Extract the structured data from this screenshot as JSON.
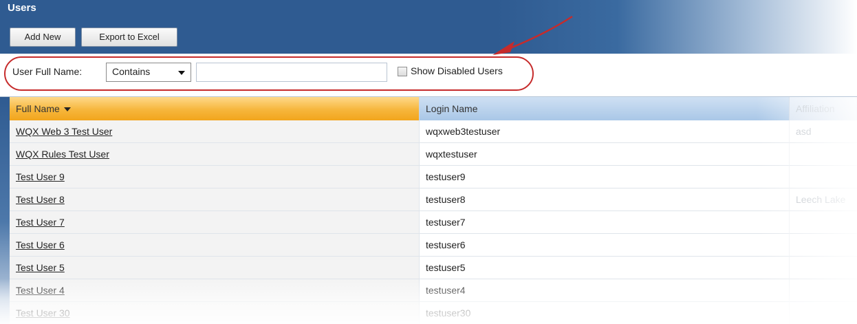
{
  "header": {
    "title": "Users",
    "add_new_label": "Add New",
    "export_label": "Export to Excel"
  },
  "filter": {
    "label": "User Full Name:",
    "operator_selected": "Contains",
    "value": "",
    "show_disabled_label": "Show Disabled Users",
    "show_disabled_checked": false
  },
  "grid": {
    "columns": [
      "Full Name",
      "Login Name",
      "Affiliation"
    ],
    "sort_column": "Full Name",
    "sort_direction": "descending",
    "rows": [
      {
        "full_name": "WQX Web 3 Test User",
        "login": "wqxweb3testuser",
        "affiliation": "asd"
      },
      {
        "full_name": "WQX Rules Test User",
        "login": "wqxtestuser",
        "affiliation": ""
      },
      {
        "full_name": "Test User 9",
        "login": "testuser9",
        "affiliation": ""
      },
      {
        "full_name": "Test User 8",
        "login": "testuser8",
        "affiliation": "Leech Lake"
      },
      {
        "full_name": "Test User 7",
        "login": "testuser7",
        "affiliation": ""
      },
      {
        "full_name": "Test User 6",
        "login": "testuser6",
        "affiliation": ""
      },
      {
        "full_name": "Test User 5",
        "login": "testuser5",
        "affiliation": ""
      },
      {
        "full_name": "Test User 4",
        "login": "testuser4",
        "affiliation": ""
      },
      {
        "full_name": "Test User 30",
        "login": "testuser30",
        "affiliation": ""
      }
    ]
  },
  "colors": {
    "header_blue": "#2f5b91",
    "sorted_header_orange": "#f6b63c",
    "annotation_red": "#c62b2b"
  }
}
